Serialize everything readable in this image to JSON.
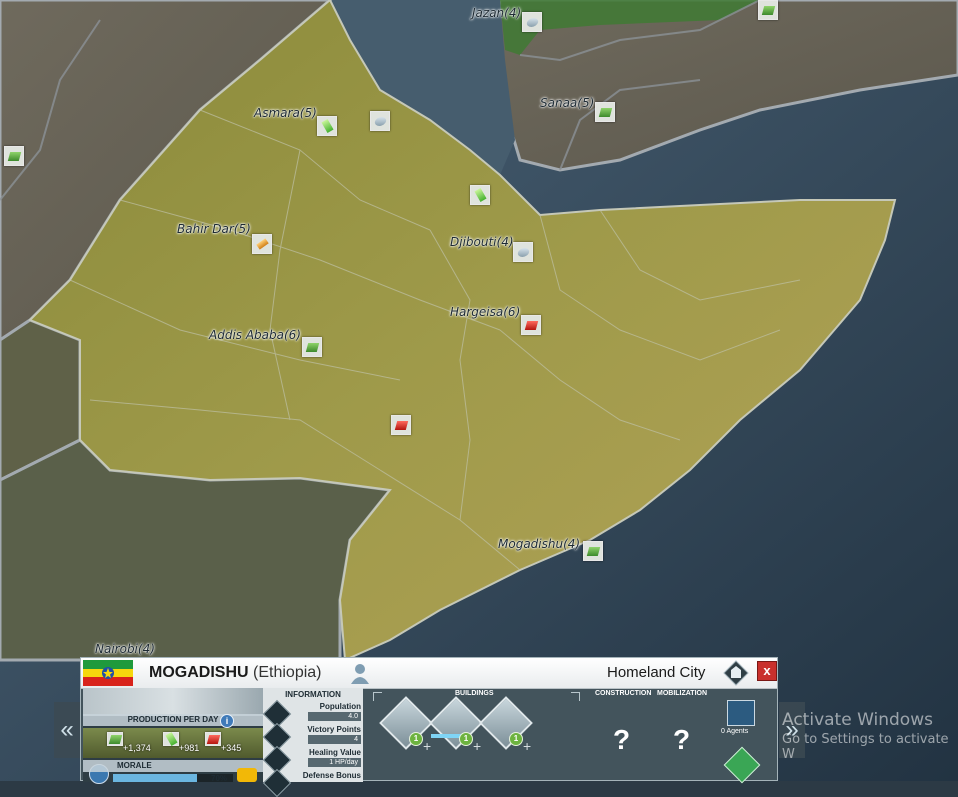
{
  "map": {
    "cities": [
      {
        "name": "Jazan(4)",
        "resource": "steel"
      },
      {
        "name": "Sanaa(5)",
        "resource": "green"
      },
      {
        "name": "Asmara(5)",
        "resource": "brightgreen"
      },
      {
        "name": "Bahir Dar(5)",
        "resource": "gold"
      },
      {
        "name": "Djibouti(4)",
        "resource": "steel"
      },
      {
        "name": "Hargeisa(6)",
        "resource": "red"
      },
      {
        "name": "Addis Ababa(6)",
        "resource": "green"
      },
      {
        "name": "Mogadishu(4)",
        "resource": "green"
      },
      {
        "name": "Nairobi(4)",
        "resource": ""
      }
    ]
  },
  "panel": {
    "city_name": "MOGADISHU",
    "country": "(Ethiopia)",
    "city_type": "Homeland City",
    "close_label": "x",
    "production_label": "PRODUCTION PER DAY",
    "production_info": "i",
    "production_values": [
      "+1,374",
      "+981",
      "+345"
    ],
    "morale_label": "MORALE",
    "morale_value": "70%",
    "morale_fraction": 0.7,
    "information_label": "INFORMATION",
    "info_rows": [
      {
        "label": "Population",
        "value": "4.0"
      },
      {
        "label": "Victory Points",
        "value": "4"
      },
      {
        "label": "Healing Value",
        "value": "1 HP/day"
      },
      {
        "label": "Defense Bonus",
        "value": ""
      }
    ],
    "buildings_label": "BUILDINGS",
    "building_levels": [
      "1",
      "1",
      "1"
    ],
    "construction_label": "CONSTRUCTION",
    "mobilization_label": "MOBILIZATION",
    "construction_value": "?",
    "mobilization_value": "?",
    "agents_label": "0 Agents"
  },
  "nav": {
    "prev": "«",
    "next": "»"
  },
  "watermark": {
    "line1": "Activate Windows",
    "line2": "Go to Settings to activate W"
  }
}
